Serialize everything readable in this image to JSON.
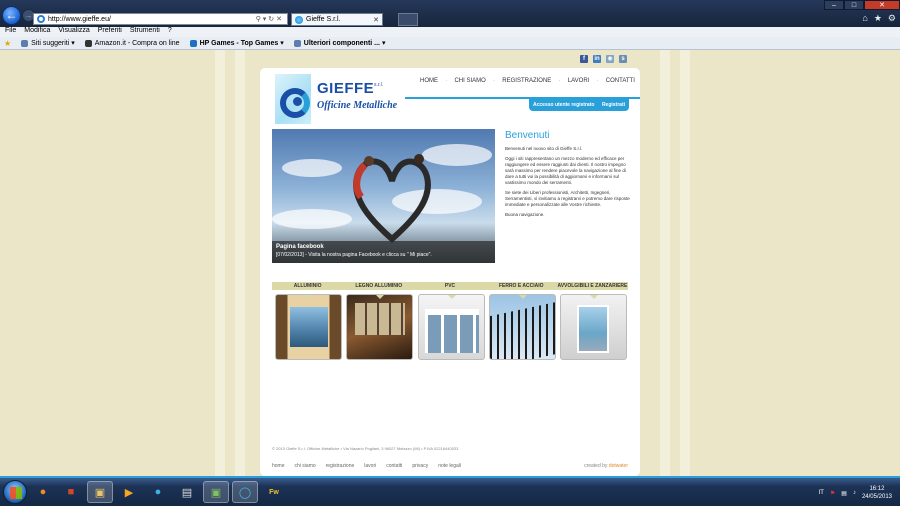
{
  "browser": {
    "url": "http://www.gieffe.eu/",
    "tab_title": "Gieffe S.r.l.",
    "menu": [
      "File",
      "Modifica",
      "Visualizza",
      "Preferiti",
      "Strumenti",
      "?"
    ],
    "favorites": [
      {
        "label": "Siti suggeriti ▾"
      },
      {
        "label": "Amazon.it - Compra on line"
      },
      {
        "label": "HP Games - Top Games ▾"
      },
      {
        "label": "Ulteriori componenti ... ▾"
      }
    ]
  },
  "site": {
    "brand": "GIEFFE",
    "brand_suffix": "s.r.l.",
    "tagline": "Officine Metalliche",
    "nav": [
      "HOME",
      "CHI SIAMO",
      "REGISTRAZIONE",
      "LAVORI",
      "CONTATTI"
    ],
    "login_label": "Accesso utente registrato",
    "register_label": "Registrati",
    "hero": {
      "caption_title": "Pagina facebook",
      "caption_text": "[07/02/2013] - Visita la nostra pagina Facebook e clicca su \" Mi piace\"."
    },
    "welcome": {
      "title": "Benvenuti",
      "paragraphs": [
        "Benvenuti nel nuovo sito di Gieffe S.r.l.",
        "Oggi i siti rappresentano un mezzo moderno ed efficace per raggiungere ed essere raggiunti dai clienti. Il nostro impegno sarà massimo per rendere piacevole la navigazione al fine di dare a tutti voi la possibilità di aggiornarvi e informarvi sul vastissimo mondo dei serramenti.",
        "Se siete dei Liberi professionisti, Architetti, Ingegneri, Serramentisti, vi invitiamo a registrarvi e potremo dare risposte immediate e personalizzate alle Vostre richieste.",
        "Buona navigazione."
      ]
    },
    "categories": [
      "ALLUMINIO",
      "LEGNO ALLUMINIO",
      "PVC",
      "FERRO E ACCIAIO",
      "AVVOLGIBILI E ZANZARIERE"
    ],
    "copyright": "© 2013 Gieffe S.r.l. Officine Metalliche • Via Nazario Pogliani, 3 96027 Melazzo (MI) • P.IVA 02216440033",
    "footer_links": [
      "home",
      "chi siamo",
      "registrazione",
      "lavori",
      "contatti",
      "privacy",
      "note legali"
    ],
    "credit_prefix": "created by",
    "credit_name": "dotwater"
  },
  "taskbar": {
    "lang": "IT",
    "time": "16:12",
    "date": "24/05/2013"
  },
  "colors": {
    "accent": "#2aa0da",
    "brand": "#1a4fa8",
    "page_bg": "#ebe6c8",
    "category_bar": "#dcd9a8"
  }
}
